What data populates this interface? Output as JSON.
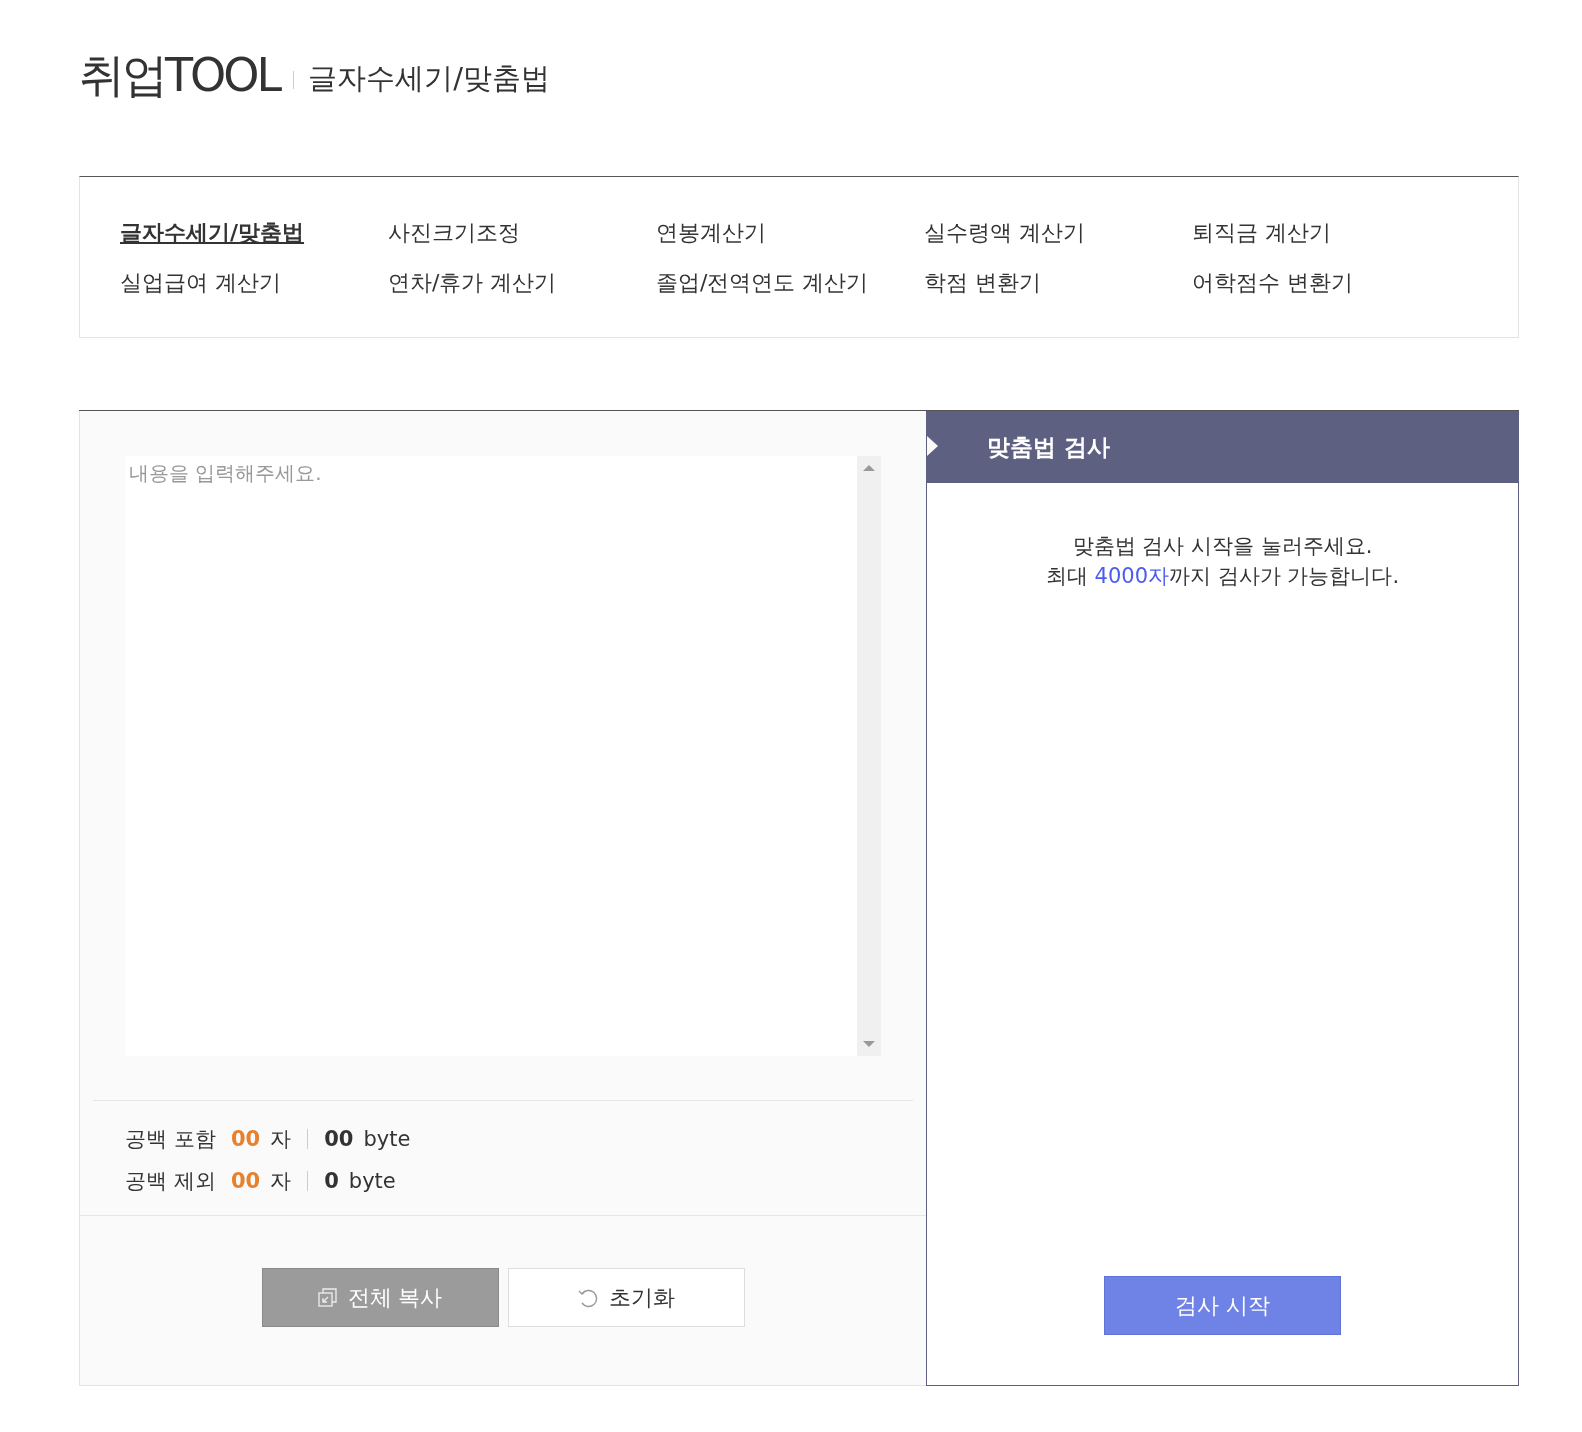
{
  "header": {
    "logo": "취업TOOL",
    "title": "글자수세기/맞춤법"
  },
  "nav": {
    "items": [
      {
        "label": "글자수세기/맞춤법",
        "selected": true
      },
      {
        "label": "사진크기조정",
        "selected": false
      },
      {
        "label": "연봉계산기",
        "selected": false
      },
      {
        "label": "실수령액 계산기",
        "selected": false
      },
      {
        "label": "퇴직금 계산기",
        "selected": false
      },
      {
        "label": "실업급여 계산기",
        "selected": false
      },
      {
        "label": "연차/휴가 계산기",
        "selected": false
      },
      {
        "label": "졸업/전역연도 계산기",
        "selected": false
      },
      {
        "label": "학점 변환기",
        "selected": false
      },
      {
        "label": "어학점수 변환기",
        "selected": false
      }
    ]
  },
  "editor": {
    "placeholder": "내용을 입력해주세요.",
    "stats": [
      {
        "label": "공백 포함",
        "chars": "00",
        "char_unit": "자",
        "bytes": "00",
        "byte_unit": "byte"
      },
      {
        "label": "공백 제외",
        "chars": "00",
        "char_unit": "자",
        "bytes": "0",
        "byte_unit": "byte"
      }
    ],
    "buttons": [
      {
        "kind": "copy",
        "label": "전체 복사"
      },
      {
        "kind": "reset",
        "label": "초기화"
      }
    ]
  },
  "spellcheck": {
    "title": "맞춤법 검사",
    "line_1": "맞춤법 검사 시작을 눌러주세요.",
    "line_2_before": "최대 ",
    "line_2_highlight": "4000자",
    "line_2_after": "까지 검사가 가능합니다.",
    "button": "검사 시작"
  }
}
